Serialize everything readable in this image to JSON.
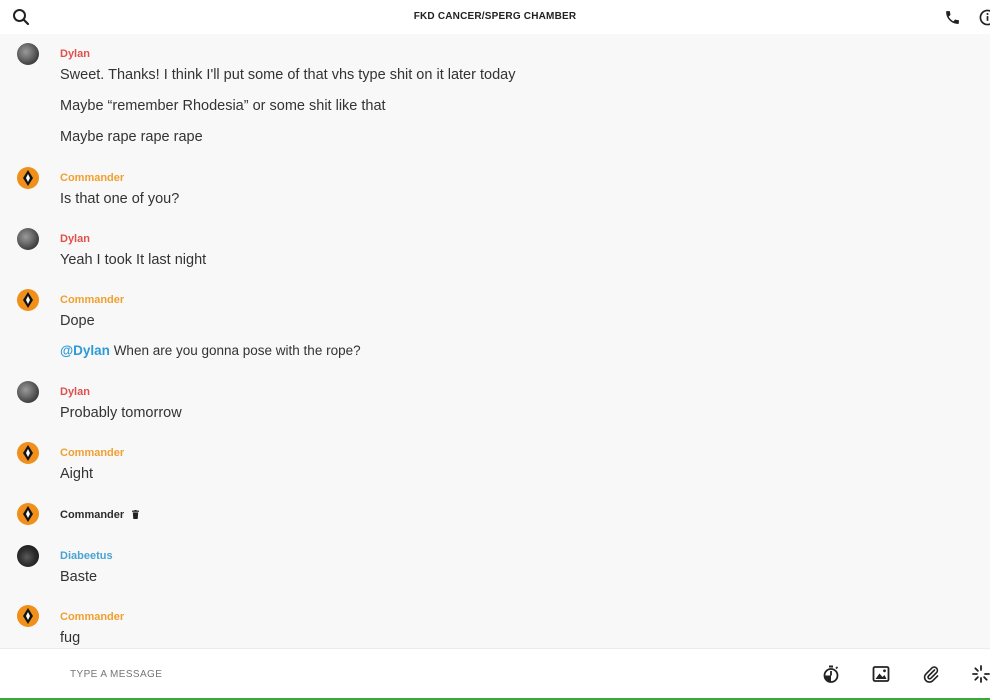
{
  "header": {
    "title": "FKD CANCER/SPERG CHAMBER"
  },
  "colors": {
    "dylan": "#e0514a",
    "commander": "#f0a030",
    "diabeetus": "#4aa4cf",
    "mention": "#2d9bd6"
  },
  "messages": [
    {
      "author": "Dylan",
      "lines": [
        "Sweet. Thanks! I think I'll put some of that vhs type shit on it later today",
        "Maybe “remember Rhodesia” or some shit like that",
        "Maybe rape rape rape"
      ]
    },
    {
      "author": "Commander",
      "lines": [
        "Is that one of you?"
      ]
    },
    {
      "author": "Dylan",
      "lines": [
        "Yeah I took It last night"
      ]
    },
    {
      "author": "Commander",
      "lines": [
        "Dope"
      ],
      "mention_line": {
        "mention": "@Dylan",
        "text": " When are you gonna pose with the rope?"
      }
    },
    {
      "author": "Dylan",
      "lines": [
        "Probably tomorrow"
      ]
    },
    {
      "author": "Commander",
      "lines": [
        "Aight"
      ]
    },
    {
      "author": "Commander",
      "lines": []
    },
    {
      "author": "Diabeetus",
      "lines": [
        "Baste"
      ]
    },
    {
      "author": "Commander",
      "lines": [
        "fug"
      ]
    }
  ],
  "composer": {
    "placeholder": "TYPE A MESSAGE"
  },
  "icons": {
    "header": [
      "search-icon",
      "phone-icon",
      "info-icon"
    ],
    "composer": [
      "timer-icon",
      "image-icon",
      "attachment-icon",
      "loading-icon"
    ],
    "badge": "trash-icon"
  }
}
